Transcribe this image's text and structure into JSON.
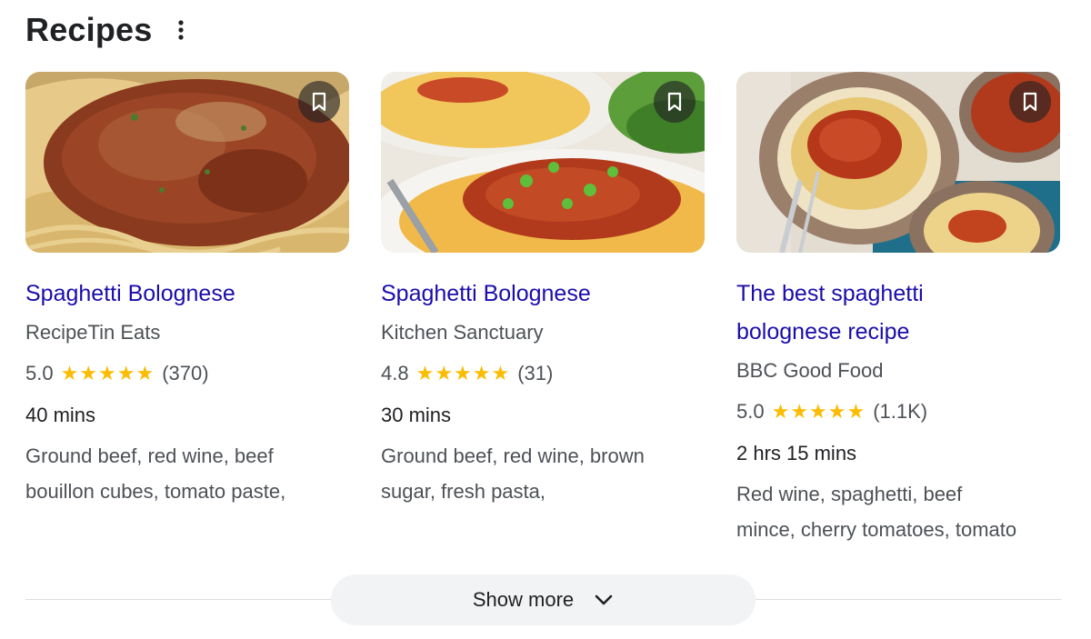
{
  "header": {
    "title": "Recipes"
  },
  "recipes": [
    {
      "title_lines": [
        "Spaghetti Bolognese"
      ],
      "source": "RecipeTin Eats",
      "rating": "5.0",
      "stars": "★★★★★",
      "reviews": "(370)",
      "time": "40 mins",
      "ingredients_lines": [
        "Ground beef, red wine, beef",
        "bouillon cubes, tomato paste,"
      ]
    },
    {
      "title_lines": [
        "Spaghetti Bolognese"
      ],
      "source": "Kitchen Sanctuary",
      "rating": "4.8",
      "stars": "★★★★★",
      "reviews": "(31)",
      "time": "30 mins",
      "ingredients_lines": [
        "Ground beef, red wine, brown",
        "sugar, fresh pasta,"
      ]
    },
    {
      "title_lines": [
        "The best spaghetti",
        "bolognese recipe"
      ],
      "source": "BBC Good Food",
      "rating": "5.0",
      "stars": "★★★★★",
      "reviews": "(1.1K)",
      "time": "2 hrs 15 mins",
      "ingredients_lines": [
        "Red wine, spaghetti, beef",
        "mince, cherry tomatoes, tomato"
      ]
    }
  ],
  "footer": {
    "show_more_label": "Show more"
  },
  "colors": {
    "link": "#1a0dab",
    "star": "#fbbc04",
    "secondary_text": "#4d5156"
  },
  "icons": {
    "menu": "more-vert-icon",
    "save": "bookmark-icon",
    "expand": "chevron-down-icon"
  }
}
